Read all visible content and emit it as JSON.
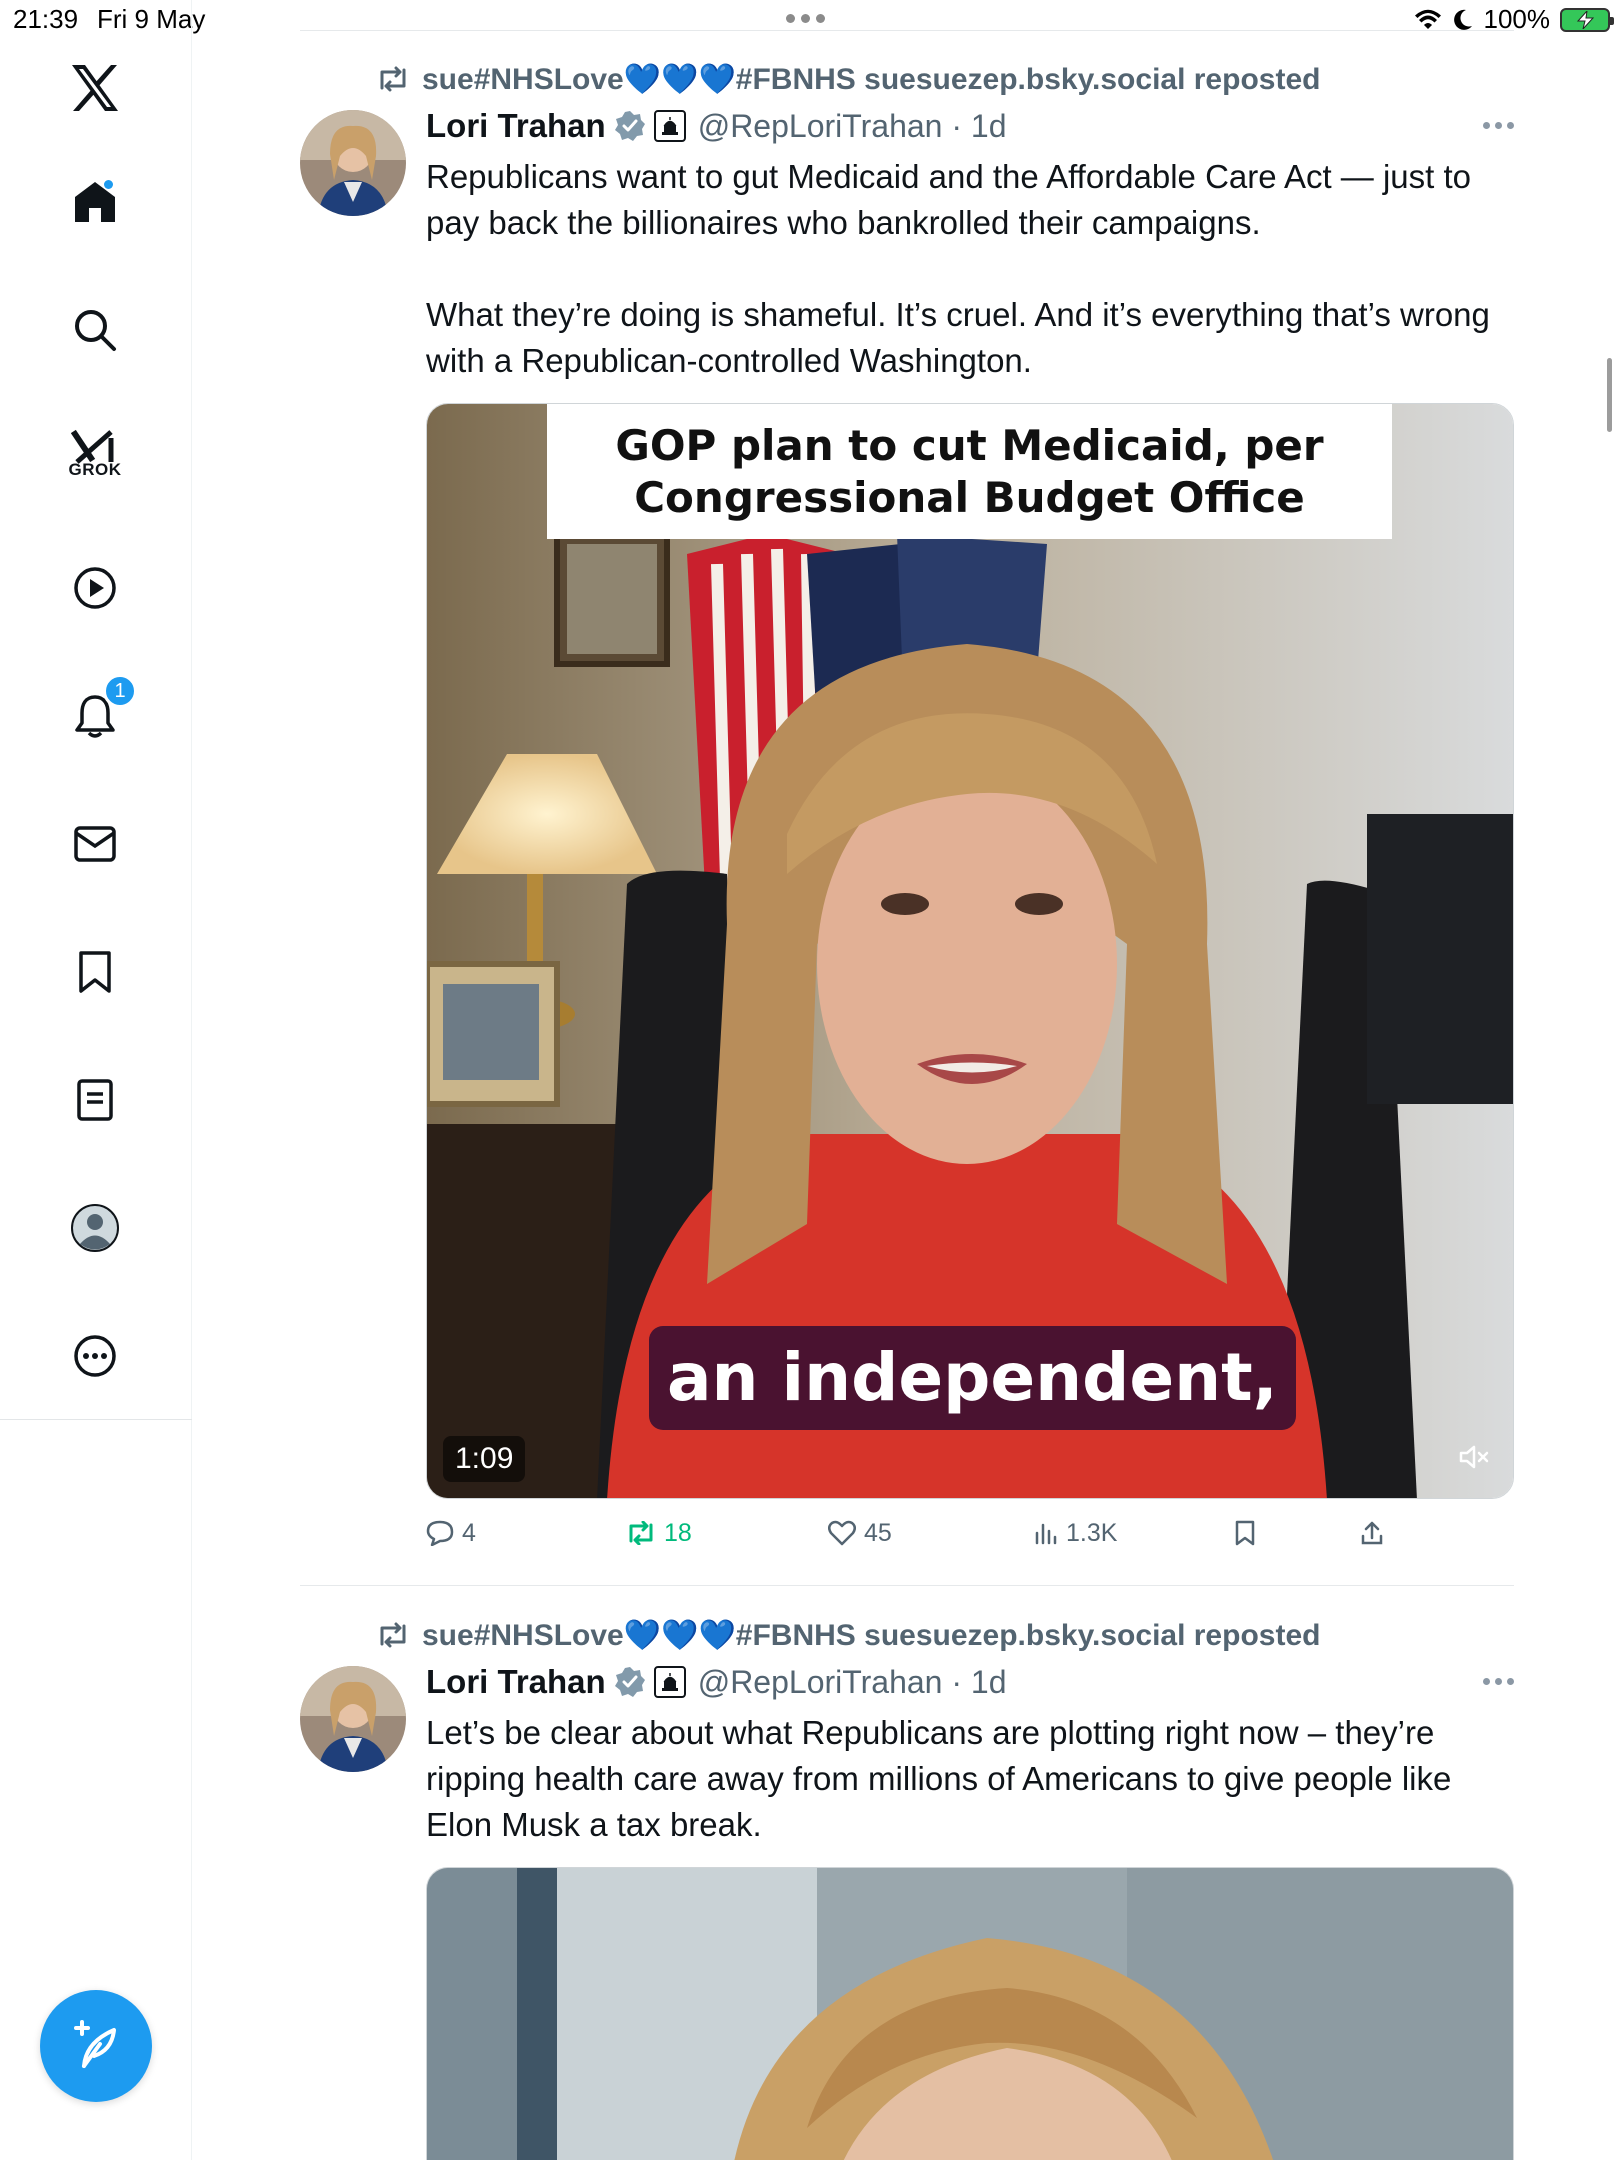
{
  "status_bar": {
    "time": "21:39",
    "date": "Fri 9 May",
    "battery": "100%"
  },
  "sidebar": {
    "grok_label": "GROK",
    "notification_count": "1",
    "icons": [
      "x-logo-icon",
      "home-icon",
      "search-icon",
      "grok-icon",
      "video-icon",
      "notifications-icon",
      "messages-icon",
      "bookmarks-icon",
      "lists-icon",
      "profile-icon",
      "more-icon"
    ]
  },
  "posts": [
    {
      "repost_by": "sue#NHSLove💙💙💙#FBNHS suesuezep.bsky.social reposted",
      "author_name": "Lori Trahan",
      "handle_time": "@RepLoriTrahan · 1d",
      "text_1": "Republicans want to gut Medicaid and the Affordable Care Act — just to pay back the billionaires who bankrolled their campaigns.",
      "text_2": "What they’re doing is shameful. It’s cruel. And it’s everything that’s wrong with a Republican-controlled Washington.",
      "video_title_line1": "GOP plan to cut Medicaid, per",
      "video_title_line2": "Congressional Budget Office",
      "video_subtitle": "an independent,",
      "video_duration": "1:09",
      "replies": "4",
      "reposts": "18",
      "likes": "45",
      "views": "1.3K"
    },
    {
      "repost_by": "sue#NHSLove💙💙💙#FBNHS suesuezep.bsky.social reposted",
      "author_name": "Lori Trahan",
      "handle_time": "@RepLoriTrahan · 1d",
      "text_1": "Let’s be clear about what Republicans are plotting right now  – they’re ripping health care away from millions of Americans to give people like Elon Musk a tax break."
    }
  ],
  "colors": {
    "accent": "#1d9bf0",
    "repost_green": "#00ba7c",
    "secondary_text": "#536471"
  }
}
